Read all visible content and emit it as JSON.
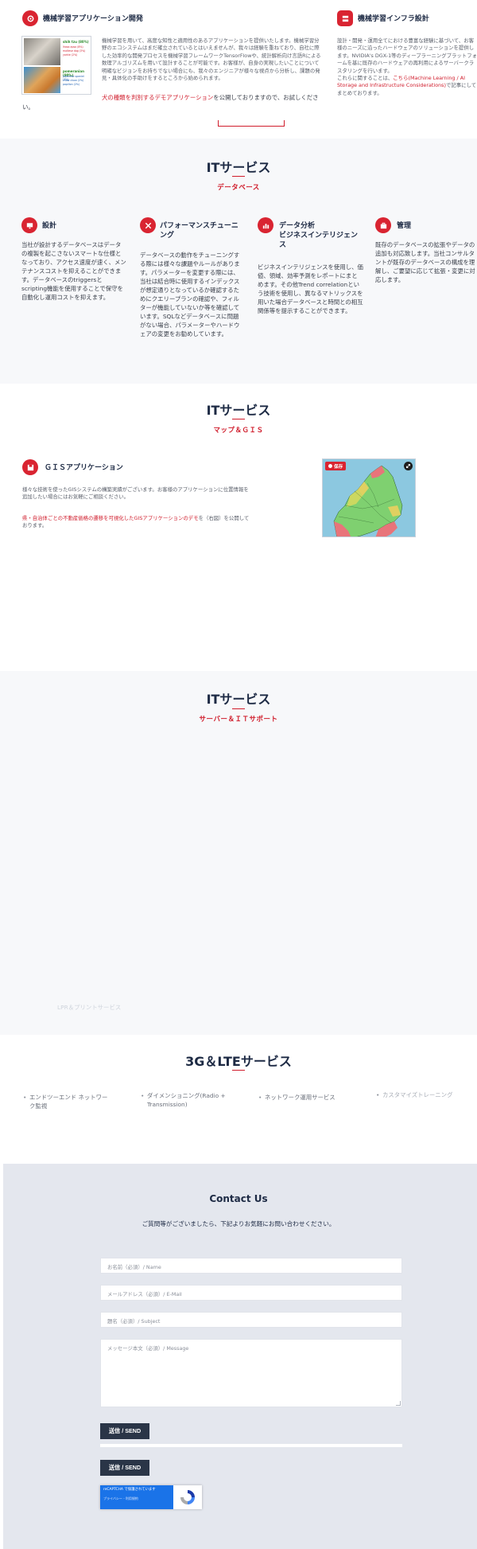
{
  "ml_app": {
    "title": "機械学習アプリケーション開発",
    "body": "機械学習を用いて、高度な知性と適用性のあるアプリケーションを提供いたします。機械学習分野のエコシステムはまだ確立されているとはいえませんが、我々は経験を重ねており、自社に際した効率的な開発プロセスを機械学習フレームワークTensorFlowや、統計解析向け言語Rによる数理アルゴリズムを用いて設計することが可能です。お客様が、自身の実現したいことについて明確なビジョンをお持ちでない場合にも、我々のエンジニアが様々な視点から分析し、課題の発見・具体化の手助けをするところから始められます。",
    "demo_link": "犬の種類を判別するデモアプリケーション",
    "demo_after": "を公開しておりますので、お試しください。",
    "thumb": [
      {
        "label": "shih tzu (80%)",
        "lines": [
          "lhasa apso (8%)",
          "maltese dog (3%)",
          "yorkie (2%)"
        ]
      },
      {
        "label": "pomeranian (90%)",
        "lines": [
          "Japanese spaniel (3%)",
          "chow chow (2%)",
          "papillon (2%)"
        ]
      }
    ]
  },
  "ml_infra": {
    "title": "機械学習インフラ設計",
    "body": "設計・開発・運用全てにおける豊富な経験に基づいて、お客様のニーズに沿ったハードウェアのソリューションを提供します。NVIDIA's DGX-1等のディープラーニングプラットフォームを基に既存のハードウェアの再利用によるサーバークラスタリングを行います。",
    "link_pre": "これらに関することは、",
    "link": "こちら(Machine Learning / AI Storage and Infrastructure Considerations)",
    "link_post": "で記事にしてまとめております。"
  },
  "db_section": {
    "title": "ITサービス",
    "subtitle": "データベース",
    "cols": [
      {
        "title": "設計",
        "body": "当社が設計するデータベースはデータの複製を起こさないスマートな仕様となっており、アクセス速度が速く、メンテナンスコストを抑えることができます。データベースのtriggersとscripting機能を使用することで保守を自動化し運用コストを抑えます。"
      },
      {
        "title": "パフォーマンスチューニング",
        "body": "データベースの動作をチューニングする際には様々な課題やルールがあります。パラメーターを変更する際には、当社は結合時に使用するインデックスが想定通りとなっているか確認するためにクエリープランの確認や、フィルターが機能していないか等を確認しています。SQLなどデータベースに問題がない場合、パラメーターやハードウェアの変更をお勧めしています。"
      },
      {
        "title": "データ分析\nビジネスインテリジェンス",
        "body": "ビジネスインテリジェンスを使用し、価値、領域、効率予測をレポートにまとめます。その他Trend correlationという技術を使用し、異なるマトリックスを用いた場合データベースと時間との相互関係等を提示することができます。"
      },
      {
        "title": "管理",
        "body": "既存のデータベースの拡張やデータの追加も対応致します。当社コンサルタントが既存のデータベースの構成を理解し、ご要望に応じて拡張・変更に対応します。"
      }
    ]
  },
  "gis_section": {
    "title": "ITサービス",
    "subtitle": "マップ＆ＧＩＳ",
    "heading": "ＧＩＳアプリケーション",
    "body": "様々な技術を使ったGISシステムの構築実績がございます。お客様のアプリケーションに位置情報を追加したい場合にはお気軽にご相談ください。",
    "link": "県・自治体ごとの不動産価格の遷移を可視化したGISアプリケーションのデモ",
    "link_after": "を（右図）を公開しております。",
    "map_badge": "保存"
  },
  "server_section": {
    "title": "ITサービス",
    "subtitle": "サーバー＆ＩＴサポート",
    "faded_item": "LPR＆プリントサービス"
  },
  "lte_section": {
    "title": "3G＆LTEサービス",
    "items": [
      "エンドツーエンド ネットワーク監視",
      "ダイメンショニング(Radio + Transmission)",
      "ネットワーク運用サービス",
      "カスタマイズトレーニング"
    ]
  },
  "contact": {
    "title": "Contact Us",
    "intro": "ご質問等がございましたら、下記よりお気軽にお問い合わせください。",
    "name_ph": "お名前（必須）/ Name",
    "email_ph": "メールアドレス（必須）/ E-Mail",
    "subject_ph": "題名（必須）/ Subject",
    "message_ph": "メッセージ本文（必須）/ Message",
    "send_label": "送信 / SEND",
    "send_label_2": "送信 / SEND",
    "recaptcha_line1": "reCAPTCHA で保護されています",
    "recaptcha_line2": "プライバシー - 利用規約"
  },
  "colors": {
    "accent": "#d01d2c",
    "navy": "#1d2a44",
    "band": "#f7f8fa",
    "contact_bg": "#e4e7ee"
  }
}
